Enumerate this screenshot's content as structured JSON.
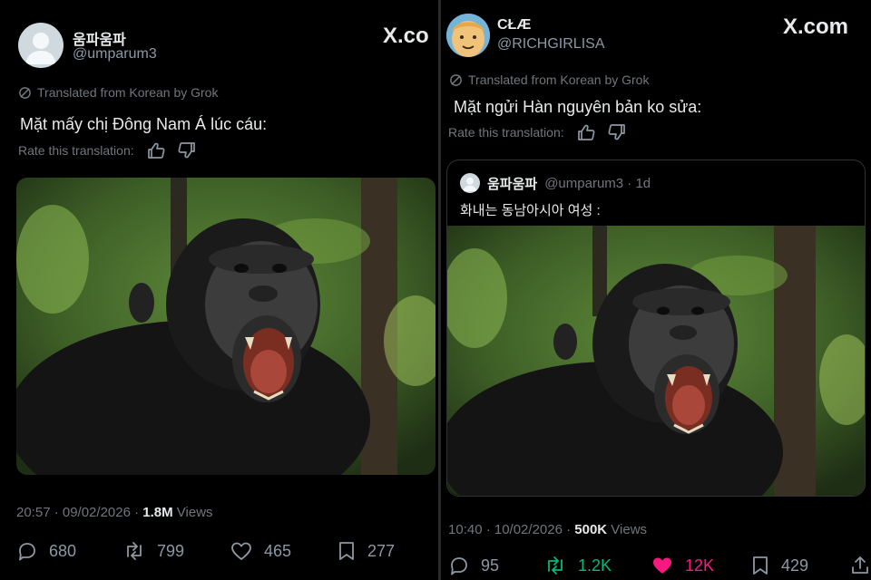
{
  "left_post": {
    "author_name": "움파움파",
    "author_handle": "@umparum3",
    "site_label": "X.co",
    "translated_note": "Translated from Korean by Grok",
    "text": "Mặt mấy chị Đông Nam Á lúc cáu:",
    "rate_label": "Rate this translation:",
    "timestamp": "20:57 · 09/02/2026 · ",
    "views_count": "1.8M",
    "views_label": " Views",
    "stats": {
      "replies": "680",
      "reposts": "799",
      "likes": "465",
      "bookmarks": "277"
    }
  },
  "right_post": {
    "author_name": "CŁÆ",
    "author_handle": "@RICHGIRLISA",
    "site_label": "X.com",
    "translated_note": "Translated from Korean by Grok",
    "text": "Mặt ngửi Hàn nguyên bản ko sửa:",
    "rate_label": "Rate this translation:",
    "quoted": {
      "author_name": "움파움파",
      "author_handle": "@umparum3 · 1d",
      "text": "화내는 동남아시아 여성 :"
    },
    "timestamp": "10:40 · 10/02/2026 · ",
    "views_count": "500K",
    "views_label": " Views",
    "stats": {
      "replies": "95",
      "reposts": "1.2K",
      "likes": "12K",
      "bookmarks": "429"
    }
  },
  "colors": {
    "background": "#000000",
    "text_primary": "#e7e9ea",
    "text_secondary": "#71767b",
    "like_active": "#f91880",
    "repost_active": "#00ba7c"
  },
  "icons": [
    "grok-icon",
    "thumbs-up-icon",
    "thumbs-down-icon",
    "reply-icon",
    "repost-icon",
    "like-icon",
    "bookmark-icon",
    "share-icon",
    "default-avatar-icon",
    "x-logo-icon"
  ]
}
